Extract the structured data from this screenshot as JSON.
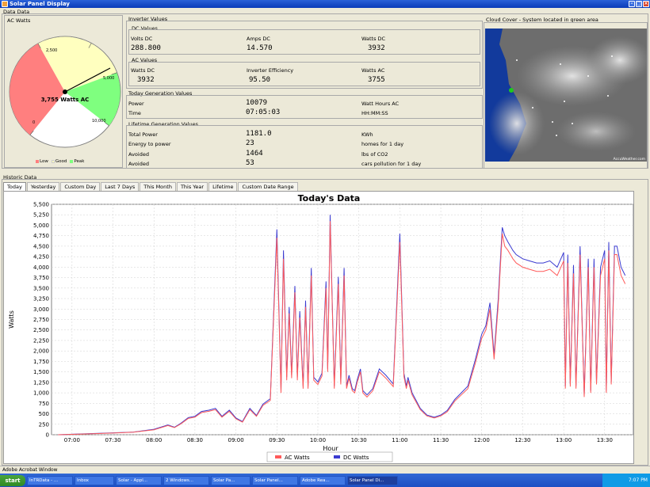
{
  "window": {
    "title": "Solar Panel Display"
  },
  "menu": {
    "data_label": "Data Data"
  },
  "ac_watts": {
    "title": "AC Watts",
    "value_text": "3,755 Watts AC",
    "value": 3755,
    "max": 5000,
    "tick_labels": [
      "2,500",
      "5,000",
      "0",
      "10,000"
    ],
    "zones": [
      {
        "name": "Low",
        "color": "#ff7f7f"
      },
      {
        "name": "Good",
        "color": "#ffffbf"
      },
      {
        "name": "Peak",
        "color": "#7fff7f"
      }
    ]
  },
  "inverter": {
    "title": "Inverter Values",
    "dc": {
      "title": "DC Values",
      "volts_label": "Volts DC",
      "volts_value": "288.800",
      "amps_label": "Amps DC",
      "amps_value": "14.570",
      "watts_label": "Watts DC",
      "watts_value": "3932"
    },
    "ac": {
      "title": "AC Values",
      "watts_dc_label": "Watts DC",
      "watts_dc_value": "3932",
      "efficiency_label": "Inverter Efficiency",
      "efficiency_value": "95.50",
      "watts_ac_label": "Watts AC",
      "watts_ac_value": "3755"
    }
  },
  "today_gen": {
    "title": "Today Generation Values",
    "power_label": "Power",
    "power_value": "10079",
    "power_unit": "Watt Hours AC",
    "time_label": "Time",
    "time_value": "07:05:03",
    "time_format": "HH:MM:SS"
  },
  "lifetime_gen": {
    "title": "Lifetime Generation Values",
    "rows": [
      {
        "label": "Total Power",
        "value": "1181.0",
        "unit": "KWh"
      },
      {
        "label": "Energy to power",
        "value": "23",
        "unit": "homes for 1 day"
      },
      {
        "label": "Avoided",
        "value": "1464",
        "unit": "lbs of CO2"
      },
      {
        "label": "Avoided",
        "value": "53",
        "unit": "cars pollution for 1 day"
      }
    ]
  },
  "cloud": {
    "title": "Cloud Cover - System located in green area",
    "credit": "AccuWeather.com"
  },
  "history": {
    "title": "Historic Data",
    "tabs": [
      "Today",
      "Yesterday",
      "Custom Day",
      "Last 7 Days",
      "This Month",
      "This Year",
      "Lifetime",
      "Custom Date Range"
    ],
    "active_tab": 0
  },
  "taskbar": {
    "start": "start",
    "items": [
      "InTRData - ...",
      "Inbox",
      "Solar - Appl...",
      "2 Windows...",
      "Solar Pa...",
      "Solar Panel...",
      "Adobe Rea...",
      "Solar Panel Di..."
    ],
    "active_item": 7,
    "clock": "7:07 PM"
  },
  "status": {
    "text": "Adobe Acrobat Window"
  },
  "chart_data": {
    "type": "line",
    "title": "Today's Data",
    "xlabel": "Hour",
    "ylabel": "Watts",
    "ylim": [
      0,
      5500
    ],
    "y_ticks": [
      0,
      250,
      500,
      750,
      1000,
      1250,
      1500,
      1750,
      2000,
      2250,
      2500,
      2750,
      3000,
      3250,
      3500,
      3750,
      4000,
      4250,
      4500,
      4750,
      5000,
      5250,
      5500
    ],
    "x_tick_labels": [
      "07:00",
      "07:30",
      "08:00",
      "08:30",
      "09:00",
      "09:30",
      "10:00",
      "10:30",
      "11:00",
      "11:30",
      "12:00",
      "12:30",
      "13:00",
      "13:30"
    ],
    "x_range_hours": [
      6.75,
      13.85
    ],
    "grid": true,
    "legend_position": "bottom",
    "series": [
      {
        "name": "AC Watts",
        "color": "#ff5a5a",
        "x": [
          6.83,
          7.0,
          7.25,
          7.5,
          7.75,
          8.0,
          8.17,
          8.25,
          8.33,
          8.42,
          8.5,
          8.58,
          8.67,
          8.75,
          8.83,
          8.92,
          9.0,
          9.08,
          9.17,
          9.25,
          9.33,
          9.42,
          9.5,
          9.55,
          9.58,
          9.62,
          9.65,
          9.68,
          9.72,
          9.75,
          9.78,
          9.82,
          9.85,
          9.88,
          9.92,
          9.95,
          10.0,
          10.05,
          10.1,
          10.12,
          10.15,
          10.2,
          10.25,
          10.28,
          10.32,
          10.35,
          10.38,
          10.42,
          10.45,
          10.48,
          10.52,
          10.55,
          10.6,
          10.67,
          10.75,
          10.83,
          10.92,
          11.0,
          11.05,
          11.08,
          11.1,
          11.15,
          11.25,
          11.33,
          11.42,
          11.5,
          11.58,
          11.67,
          11.75,
          11.83,
          11.92,
          12.0,
          12.05,
          12.1,
          12.15,
          12.2,
          12.25,
          12.28,
          12.32,
          12.35,
          12.38,
          12.42,
          12.5,
          12.58,
          12.67,
          12.75,
          12.83,
          12.92,
          13.0,
          13.02,
          13.05,
          13.08,
          13.12,
          13.15,
          13.2,
          13.25,
          13.3,
          13.33,
          13.37,
          13.4,
          13.45,
          13.5,
          13.52,
          13.55,
          13.58,
          13.62,
          13.65,
          13.7,
          13.75
        ],
        "values": [
          0,
          10,
          25,
          40,
          60,
          120,
          220,
          170,
          260,
          390,
          420,
          530,
          560,
          600,
          420,
          560,
          380,
          300,
          600,
          440,
          700,
          820,
          4700,
          1000,
          4200,
          1300,
          2900,
          1350,
          3400,
          1300,
          2800,
          1100,
          3050,
          1100,
          3800,
          1300,
          1200,
          1400,
          3500,
          1500,
          5100,
          1100,
          3600,
          1200,
          3800,
          1100,
          1350,
          1050,
          1000,
          1250,
          1500,
          1000,
          900,
          1050,
          1500,
          1350,
          1150,
          4600,
          1400,
          1100,
          1300,
          950,
          600,
          450,
          400,
          450,
          550,
          800,
          950,
          1100,
          1700,
          2300,
          2500,
          3000,
          1800,
          3050,
          4800,
          4500,
          4400,
          4300,
          4200,
          4100,
          4000,
          3950,
          3900,
          3900,
          3950,
          3800,
          4150,
          1100,
          4100,
          1150,
          3850,
          1100,
          4300,
          900,
          4000,
          1000,
          4000,
          1200,
          3800,
          4200,
          1000,
          4400,
          1200,
          4300,
          4300,
          3800,
          3600
        ]
      },
      {
        "name": "DC Watts",
        "color": "#3a3ad0",
        "x": [
          6.83,
          7.0,
          7.25,
          7.5,
          7.75,
          8.0,
          8.17,
          8.25,
          8.33,
          8.42,
          8.5,
          8.58,
          8.67,
          8.75,
          8.83,
          8.92,
          9.0,
          9.08,
          9.17,
          9.25,
          9.33,
          9.42,
          9.5,
          9.55,
          9.58,
          9.62,
          9.65,
          9.68,
          9.72,
          9.75,
          9.78,
          9.82,
          9.85,
          9.88,
          9.92,
          9.95,
          10.0,
          10.05,
          10.1,
          10.12,
          10.15,
          10.2,
          10.25,
          10.28,
          10.32,
          10.35,
          10.38,
          10.42,
          10.45,
          10.48,
          10.52,
          10.55,
          10.6,
          10.67,
          10.75,
          10.83,
          10.92,
          11.0,
          11.05,
          11.08,
          11.1,
          11.15,
          11.25,
          11.33,
          11.42,
          11.5,
          11.58,
          11.67,
          11.75,
          11.83,
          11.92,
          12.0,
          12.05,
          12.1,
          12.15,
          12.2,
          12.25,
          12.28,
          12.32,
          12.35,
          12.38,
          12.42,
          12.5,
          12.58,
          12.67,
          12.75,
          12.83,
          12.92,
          13.0,
          13.02,
          13.05,
          13.08,
          13.12,
          13.15,
          13.2,
          13.25,
          13.3,
          13.33,
          13.37,
          13.4,
          13.45,
          13.5,
          13.52,
          13.55,
          13.58,
          13.62,
          13.65,
          13.7,
          13.75
        ],
        "values": [
          0,
          12,
          28,
          45,
          65,
          130,
          235,
          180,
          275,
          410,
          440,
          555,
          585,
          630,
          440,
          585,
          400,
          315,
          630,
          460,
          730,
          860,
          4900,
          1050,
          4400,
          1380,
          3050,
          1420,
          3550,
          1370,
          2950,
          1160,
          3200,
          1160,
          3980,
          1370,
          1260,
          1470,
          3660,
          1570,
          5250,
          1160,
          3770,
          1260,
          3980,
          1160,
          1420,
          1100,
          1050,
          1310,
          1570,
          1050,
          950,
          1100,
          1570,
          1420,
          1210,
          4800,
          1470,
          1160,
          1370,
          1000,
          630,
          470,
          420,
          470,
          580,
          840,
          1000,
          1160,
          1780,
          2400,
          2600,
          3150,
          1900,
          3200,
          4950,
          4750,
          4600,
          4500,
          4400,
          4300,
          4200,
          4150,
          4100,
          4100,
          4150,
          4000,
          4350,
          1160,
          4300,
          1210,
          4050,
          1160,
          4500,
          950,
          4200,
          1050,
          4200,
          1260,
          4000,
          4400,
          1050,
          4600,
          1260,
          4500,
          4500,
          4000,
          3800
        ]
      }
    ]
  }
}
